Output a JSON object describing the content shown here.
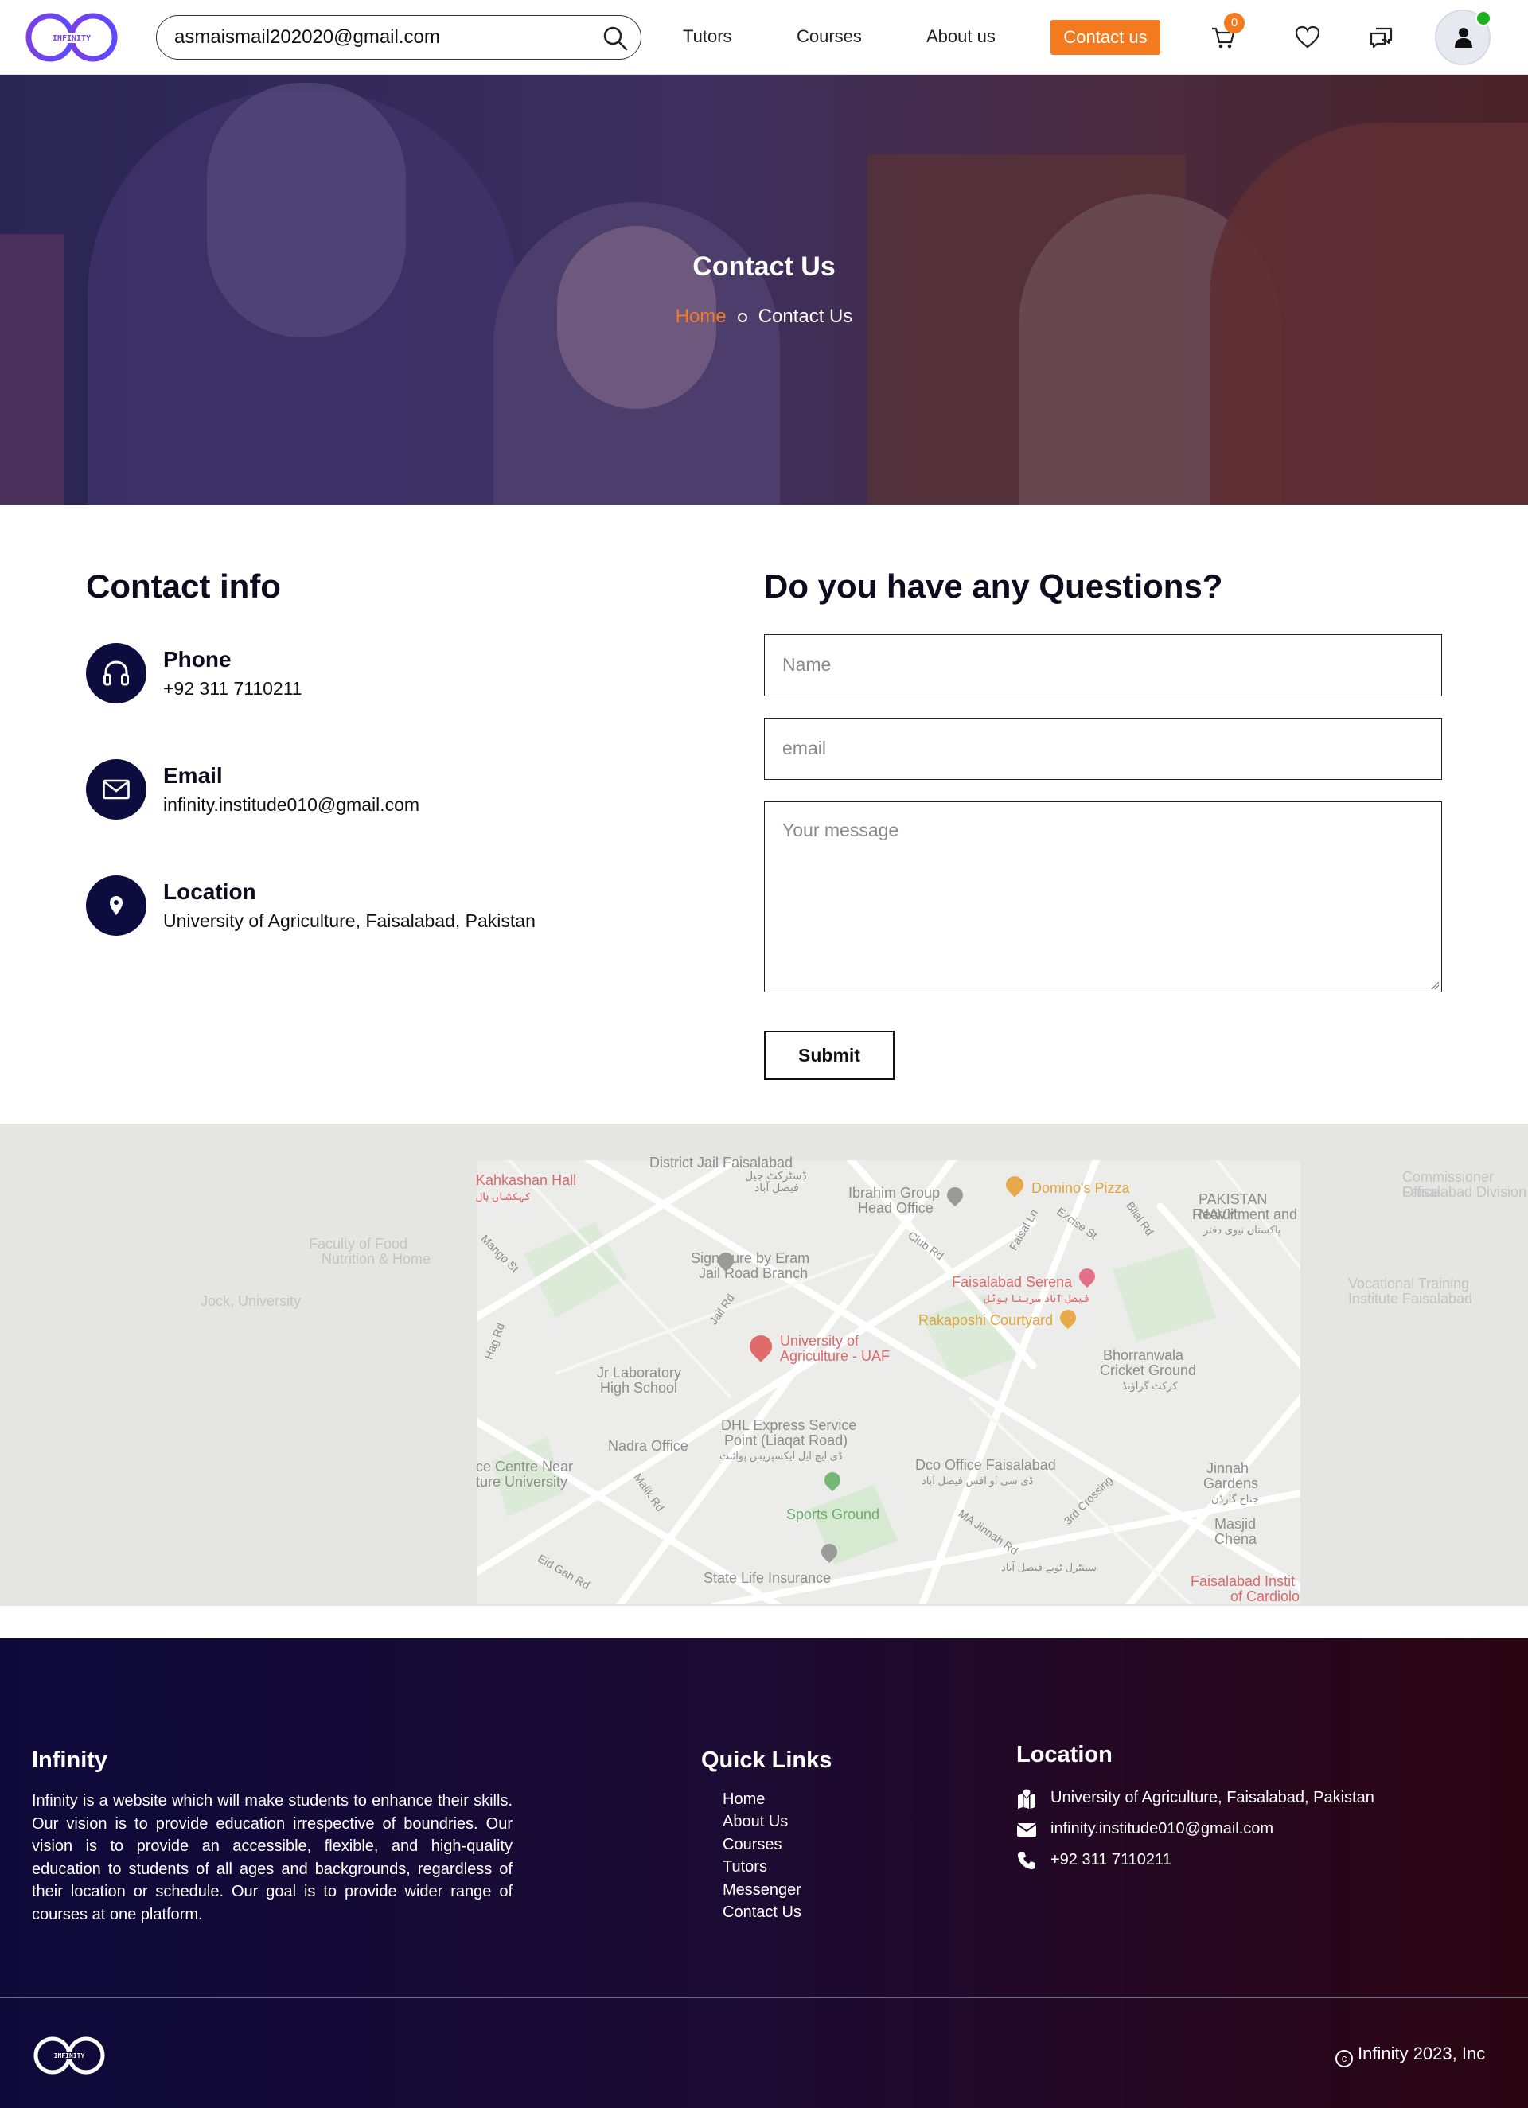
{
  "navbar": {
    "logo_text": "INFINITY",
    "search_value": "asmaismail202020@gmail.com",
    "links": [
      "Tutors",
      "Courses",
      "About us"
    ],
    "contact_label": "Contact us",
    "cart_count": "0",
    "colors": {
      "accent": "#f37a1f",
      "navy": "#0c0c3e",
      "online": "#1db01d"
    }
  },
  "hero": {
    "title": "Contact Us",
    "breadcrumb_home": "Home",
    "breadcrumb_current": "Contact Us"
  },
  "contact_info": {
    "heading": "Contact info",
    "items": [
      {
        "title": "Phone",
        "value": "+92 311 7110211",
        "icon": "headphones-icon"
      },
      {
        "title": "Email",
        "value": "infinity.institude010@gmail.com",
        "icon": "envelope-icon"
      },
      {
        "title": "Location",
        "value": "University of Agriculture, Faisalabad, Pakistan",
        "icon": "location-pin-icon"
      }
    ]
  },
  "form": {
    "heading": "Do you have any Questions?",
    "name_placeholder": "Name",
    "email_placeholder": "email",
    "message_placeholder": "Your message",
    "submit_label": "Submit"
  },
  "map": {
    "labels": [
      "District Jail Faisalabad",
      "ڈسٹرکٹ جیل",
      "فیصل آباد",
      "Kahkashan Hall",
      "کہکشاں ہال",
      "Ibrahim Group",
      "Head Office",
      "Domino's Pizza",
      "PAKISTAN NAVY",
      "Recruitment and",
      "پاکستان نیوی دفتر",
      "Commissioner Office",
      "Faisalabad Division",
      "Faculty of Food",
      "Nutrition & Home",
      "Signature by Eram",
      "Jail Road Branch",
      "Faisalabad Serena",
      "فیصل آباد سرینا ہوٹل",
      "Vocational Training",
      "Institute Faisalabad",
      "Rakaposhi Courtyard",
      "University of",
      "Agriculture - UAF",
      "Jr Laboratory",
      "High School",
      "Bhorranwala",
      "Cricket Ground",
      "کرکٹ گراؤنڈ",
      "DHL Express Service",
      "Point (Liaqat Road)",
      "ڈی ایچ ایل ایکسپریس پوائنٹ",
      "Nadra Office",
      "ce Centre Near",
      "ture University",
      "Dco Office Faisalabad",
      "ڈی سی او آفس فیصل آباد",
      "Jinnah",
      "Gardens",
      "جناح گارڈن",
      "Sports Ground",
      "Masjid Chena",
      "State Life Insurance",
      "Faisalabad Instit",
      "of Cardiolo",
      "Jail Rd",
      "Club Rd",
      "Faisal Ln",
      "Excise St",
      "Bilal Rd",
      "Malik Rd",
      "MA Jinnah Rd",
      "Eid Gah Rd",
      "3rd Crossing",
      "Hag Rd",
      "Mango St",
      "سینٹرل ٹوبے فیصل آباد",
      "Jock, University"
    ]
  },
  "footer": {
    "about_heading": "Infinity",
    "about_text": "Infinity is a website which will make students to enhance their skills. Our vision is to provide education irrespective of boundries. Our vision is to provide an accessible, flexible, and high-quality education to students of all ages and backgrounds, regardless of their location or schedule. Our goal is to provide wider range of courses at one platform.",
    "links_heading": "Quick Links",
    "links": [
      "Home",
      "About Us",
      "Courses",
      "Tutors",
      "Messenger",
      "Contact Us"
    ],
    "location_heading": "Location",
    "location_items": [
      {
        "text": "University of Agriculture, Faisalabad, Pakistan",
        "icon": "map-location-icon"
      },
      {
        "text": "infinity.institude010@gmail.com",
        "icon": "envelope-icon"
      },
      {
        "text": "+92 311 7110211",
        "icon": "phone-icon"
      }
    ],
    "logo_text": "INFINITY",
    "copyright_symbol": "c",
    "copyright": "Infinity 2023, Inc"
  }
}
